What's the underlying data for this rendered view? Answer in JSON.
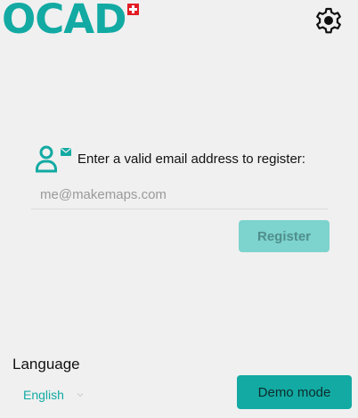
{
  "header": {
    "logo_text": "OCAD",
    "logo_flag": "swiss-flag-icon",
    "settings_icon": "gear-icon"
  },
  "register": {
    "icon": "user-email-icon",
    "prompt": "Enter a valid email address to register:",
    "email_placeholder": "me@makemaps.com",
    "email_value": "",
    "button_label": "Register"
  },
  "footer": {
    "language_heading": "Language",
    "language_selected": "English",
    "language_chevron": "chevron-down-icon",
    "demo_button_label": "Demo mode"
  },
  "colors": {
    "brand": "#12aaa3",
    "register_disabled": "#7dd3ce",
    "flag_red": "#e21d25"
  }
}
